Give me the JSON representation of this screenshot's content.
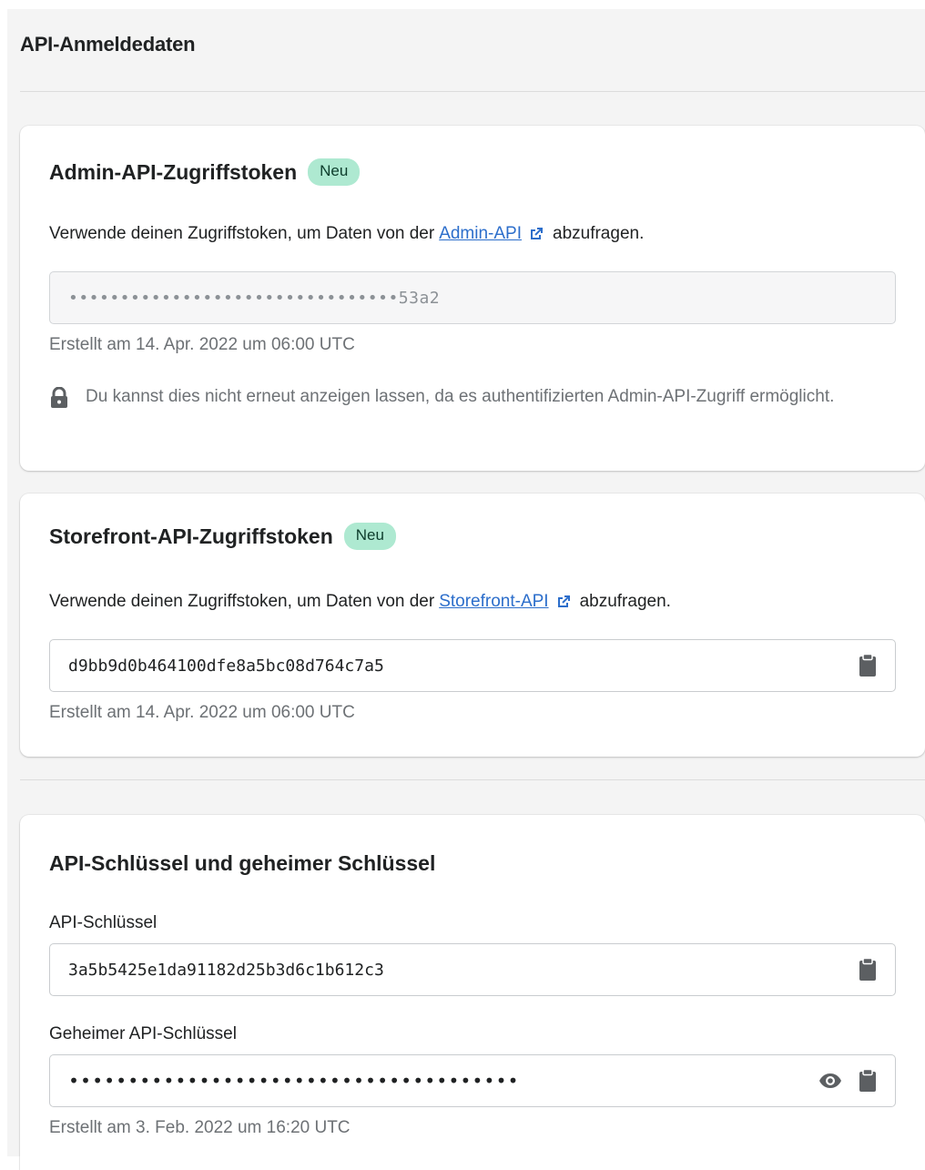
{
  "page": {
    "title": "API-Anmeldedaten"
  },
  "admin_card": {
    "title": "Admin-API-Zugriffstoken",
    "badge": "Neu",
    "desc_prefix": "Verwende deinen Zugriffstoken, um Daten von der",
    "link": "Admin-API",
    "desc_suffix": "abzufragen.",
    "token_masked": "••••••••••••••••••••••••••••••••53a2",
    "created": "Erstellt am 14. Apr. 2022 um 06:00 UTC",
    "note": "Du kannst dies nicht erneut anzeigen lassen, da es authentifizierten Admin-API-Zugriff ermöglicht."
  },
  "storefront_card": {
    "title": "Storefront-API-Zugriffstoken",
    "badge": "Neu",
    "desc_prefix": "Verwende deinen Zugriffstoken, um Daten von der",
    "link": "Storefront-API",
    "desc_suffix": "abzufragen.",
    "token": "d9bb9d0b464100dfe8a5bc08d764c7a5",
    "created": "Erstellt am 14. Apr. 2022 um 06:00 UTC"
  },
  "keys_card": {
    "title": "API-Schlüssel und geheimer Schlüssel",
    "api_key_label": "API-Schlüssel",
    "api_key": "3a5b5425e1da91182d25b3d6c1b612c3",
    "secret_label": "Geheimer API-Schlüssel",
    "secret_masked": "••••••••••••••••••••••••••••••••••••••",
    "created": "Erstellt am 3. Feb. 2022 um 16:20 UTC"
  },
  "icons": {
    "external_link": "external-link-icon",
    "lock": "lock-icon",
    "clipboard": "clipboard-icon",
    "eye": "eye-icon"
  },
  "colors": {
    "link": "#2c6ecb",
    "badge_bg": "#aee9d1",
    "page_bg": "#f4f4f4",
    "subdued_text": "#6d7175"
  }
}
